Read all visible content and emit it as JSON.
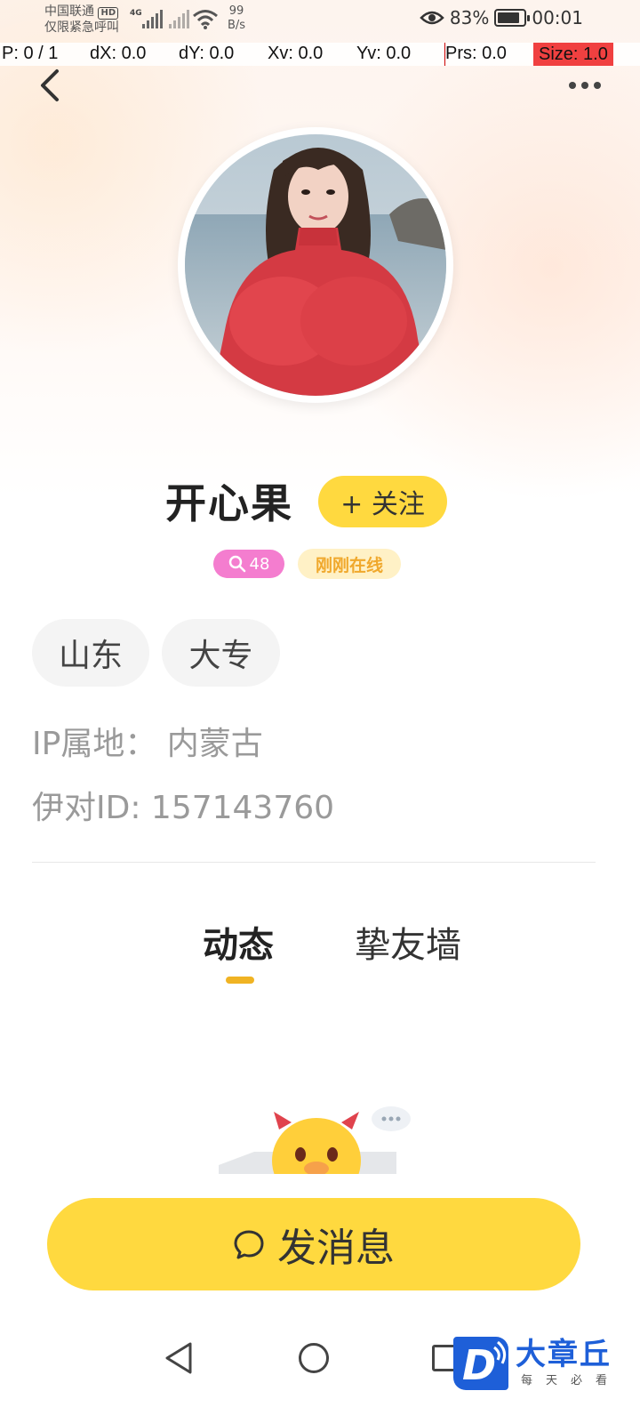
{
  "status_bar": {
    "carrier": "中国联通",
    "hd": "HD",
    "emergency": "仅限紧急呼叫",
    "network": "4G",
    "speed_value": "99",
    "speed_unit": "B/s",
    "battery": "83%",
    "time": "00:01",
    "battery_level": 0.83
  },
  "debug": {
    "p": "P: 0 / 1",
    "dx": "dX: 0.0",
    "dy": "dY: 0.0",
    "xv": "Xv: 0.0",
    "yv": "Yv: 0.0",
    "prs": "Prs: 0.0",
    "size": "Size: 1.0"
  },
  "profile": {
    "name": "开心果",
    "follow_label": "+ 关注",
    "charm_count": "48",
    "online_status": "刚刚在线",
    "tags": [
      "山东",
      "大专"
    ],
    "ip_location": "IP属地：  内蒙古",
    "user_id": "伊对ID: 157143760"
  },
  "tabs": {
    "active": "动态",
    "inactive": "挚友墙"
  },
  "actions": {
    "send_message": "发消息"
  },
  "watermark": {
    "letter": "D",
    "title": "大章丘",
    "subtitle": "每天必看"
  },
  "colors": {
    "accent_yellow": "#ffd93f",
    "pink_badge": "#f47dcf",
    "online_text": "#f0a82c",
    "tab_indicator": "#f0b323",
    "watermark_blue": "#1e5fd8"
  },
  "icons": {
    "back": "chevron-left-icon",
    "more": "more-dots-icon",
    "charm": "search-heart-icon",
    "message": "chat-bubble-icon"
  }
}
